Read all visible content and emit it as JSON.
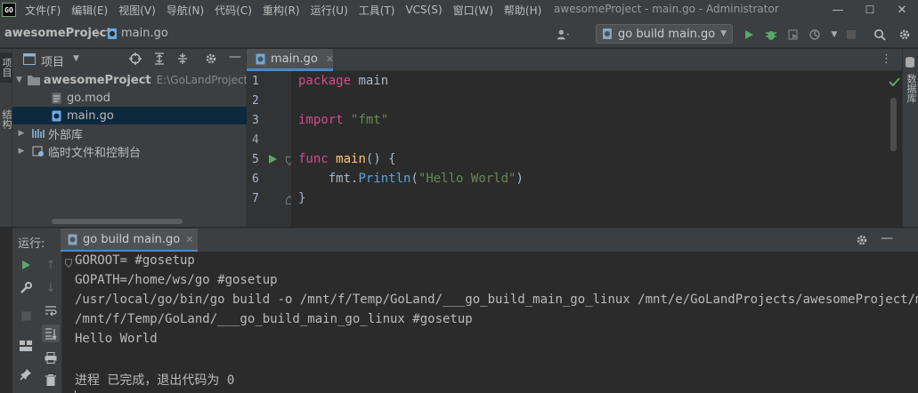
{
  "app": {
    "logo_text": "GO",
    "window_title": "awesomeProject - main.go - Administrator",
    "menu": [
      "文件(F)",
      "编辑(E)",
      "视图(V)",
      "导航(N)",
      "代码(C)",
      "重构(R)",
      "运行(U)",
      "工具(T)",
      "VCS(S)",
      "窗口(W)",
      "帮助(H)"
    ],
    "window_controls": {
      "minimize": "—",
      "maximize": "☐",
      "close": "✕"
    }
  },
  "navbar": {
    "project": "awesomeProject",
    "separator": "〉",
    "file": "main.go",
    "run_config": "go build main.go",
    "icons": [
      "user-icon",
      "run-icon",
      "debug-icon",
      "coverage-icon",
      "profile-icon",
      "stop-icon",
      "search-icon",
      "settings-icon"
    ]
  },
  "left_stripe": {
    "tab1": "项目",
    "tab2": "结构"
  },
  "right_stripe": {
    "tab1": "数据库"
  },
  "project_panel": {
    "title": "项目",
    "tree": [
      {
        "label": "awesomeProject",
        "hint": "E:\\GoLandProjects\\a",
        "depth": 0,
        "expanded": true,
        "icon": "folder-icon"
      },
      {
        "label": "go.mod",
        "depth": 1,
        "icon": "gomod-file-icon"
      },
      {
        "label": "main.go",
        "depth": 1,
        "selected": true,
        "icon": "go-file-icon"
      },
      {
        "label": "外部库",
        "depth": 0,
        "icon": "library-icon"
      },
      {
        "label": "临时文件和控制台",
        "depth": 0,
        "icon": "scratch-icon"
      }
    ]
  },
  "editor": {
    "tab_label": "main.go",
    "line_numbers": [
      "1",
      "2",
      "3",
      "4",
      "5",
      "6",
      "7"
    ],
    "lines": [
      "package main",
      "",
      "import \"fmt\"",
      "",
      "func main() {",
      "    fmt.Println(\"Hello World\")",
      "}"
    ],
    "status": "no-problems"
  },
  "run_window": {
    "title": "运行:",
    "tab_label": "go build main.go",
    "console": [
      "GOROOT= #gosetup",
      "GOPATH=/home/ws/go #gosetup",
      "/usr/local/go/bin/go build -o /mnt/f/Temp/GoLand/___go_build_main_go_linux /mnt/e/GoLandProjects/awesomeProject/main.go",
      "/mnt/f/Temp/GoLand/___go_build_main_go_linux #gosetup",
      "Hello World",
      "",
      "进程 已完成，退出代码为 0"
    ]
  },
  "colors": {
    "accent": "#4a88c7",
    "run_green": "#59a869",
    "selection": "#0d293e"
  }
}
